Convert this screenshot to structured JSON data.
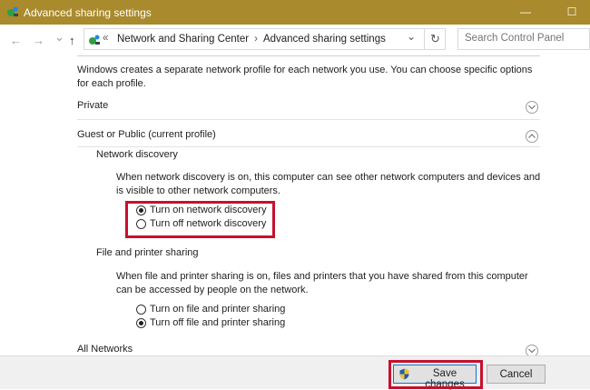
{
  "window": {
    "title": "Advanced sharing settings",
    "minimize_glyph": "—",
    "maximize_glyph": "☐"
  },
  "navigation": {
    "back_glyph": "←",
    "forward_glyph": "→",
    "history_glyph": "⌄",
    "up_glyph": "↑",
    "overflow_glyph": "«",
    "breadcrumb": [
      "Network and Sharing Center",
      "Advanced sharing settings"
    ],
    "separator": "›",
    "dropdown_glyph": "⌄",
    "refresh_glyph": "↻",
    "search_placeholder": "Search Control Panel"
  },
  "content": {
    "intro": "Windows creates a separate network profile for each network you use. You can choose specific options for each profile.",
    "private_label": "Private",
    "guest_label": "Guest or Public (current profile)",
    "network_discovery": {
      "heading": "Network discovery",
      "description": "When network discovery is on, this computer can see other network computers and devices and is visible to other network computers.",
      "options": [
        "Turn on network discovery",
        "Turn off network discovery"
      ],
      "selected_index": 0
    },
    "file_printer_sharing": {
      "heading": "File and printer sharing",
      "description": "When file and printer sharing is on, files and printers that you have shared from this computer can be accessed by people on the network.",
      "options": [
        "Turn on file and printer sharing",
        "Turn off file and printer sharing"
      ],
      "selected_index": 1
    },
    "all_networks_label": "All Networks"
  },
  "footer": {
    "save_label": "Save changes",
    "cancel_label": "Cancel"
  },
  "colors": {
    "titlebar": "#a98a2c",
    "highlight": "#c8102e",
    "primary_border": "#0078d7"
  },
  "icons": {
    "app": "network-center-icon",
    "expand": "chevron-down-icon",
    "collapse": "chevron-up-icon",
    "save": "uac-shield-icon"
  }
}
